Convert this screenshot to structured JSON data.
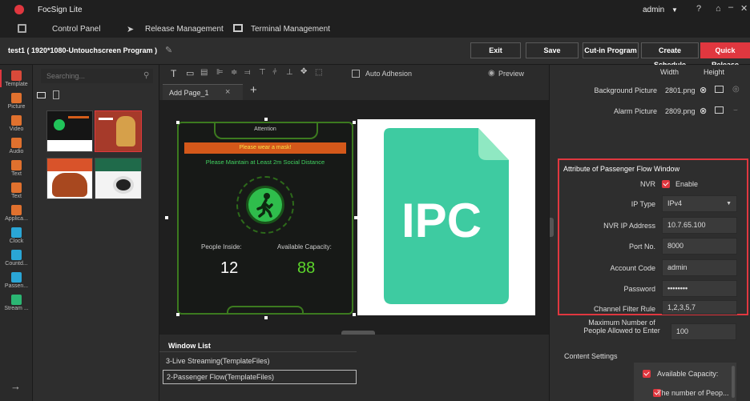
{
  "app": {
    "title": "FocSign Lite",
    "user": "admin"
  },
  "menu": {
    "control_panel": "Control Panel",
    "release": "Release Management",
    "terminal": "Terminal Management"
  },
  "program": {
    "title": "test1 ( 1920*1080-Untouchscreen Program )",
    "exit": "Exit",
    "save": "Save",
    "cutin": "Cut-in Program",
    "schedule": "Create Schedule",
    "quick": "Quick Release"
  },
  "nav": [
    {
      "label": "Template",
      "color": "#d94a3a"
    },
    {
      "label": "Picture",
      "color": "#e0712e"
    },
    {
      "label": "Video",
      "color": "#e0712e"
    },
    {
      "label": "Audio",
      "color": "#e0712e"
    },
    {
      "label": "Text",
      "color": "#e0712e"
    },
    {
      "label": "Text",
      "color": "#e0712e"
    },
    {
      "label": "Applica...",
      "color": "#e0712e"
    },
    {
      "label": "Clock",
      "color": "#2aa6d6"
    },
    {
      "label": "Countd...",
      "color": "#2aa6d6"
    },
    {
      "label": "Passen...",
      "color": "#2aa6d6"
    },
    {
      "label": "Stream ...",
      "color": "#2bb673"
    }
  ],
  "search": {
    "placeholder": "Searching..."
  },
  "toolbar": {
    "auto_adhesion": "Auto Adhesion",
    "preview": "Preview"
  },
  "tabs": {
    "page": "Add Page_1",
    "close": "×",
    "add": "+"
  },
  "widget": {
    "attention": "Attention",
    "mask": "Please wear a mask!",
    "distance": "Please Maintain at Least 2m Social Distance",
    "inside_label": "People Inside:",
    "capacity_label": "Available Capacity:",
    "inside": "12",
    "capacity": "88"
  },
  "ipc": {
    "text": "IPC"
  },
  "window_list": {
    "title": "Window List",
    "items": [
      "3-Live Streaming(TemplateFiles)",
      "2-Passenger Flow(TemplateFiles)"
    ]
  },
  "right": {
    "width": "Width",
    "height": "Height",
    "bg_label": "Background Picture",
    "bg_value": "2801.png",
    "alarm_label": "Alarm Picture",
    "alarm_value": "2809.png",
    "section": "Attribute of Passenger Flow Window",
    "nvr_label": "NVR",
    "nvr_enable": "Enable",
    "iptype_label": "IP Type",
    "iptype": "IPv4",
    "ip_label": "NVR IP Address",
    "ip": "10.7.65.100",
    "port_label": "Port No.",
    "port": "8000",
    "account_label": "Account Code",
    "account": "admin",
    "password_label": "Password",
    "password": "••••••••",
    "filter_label": "Channel Filter Rule",
    "filter": "1,2,3,5,7",
    "max_label": "Maximum Number of People Allowed to Enter",
    "max": "100",
    "content": "Content Settings",
    "opt1": "Available Capacity:",
    "opt2": "The number of Peop..."
  }
}
